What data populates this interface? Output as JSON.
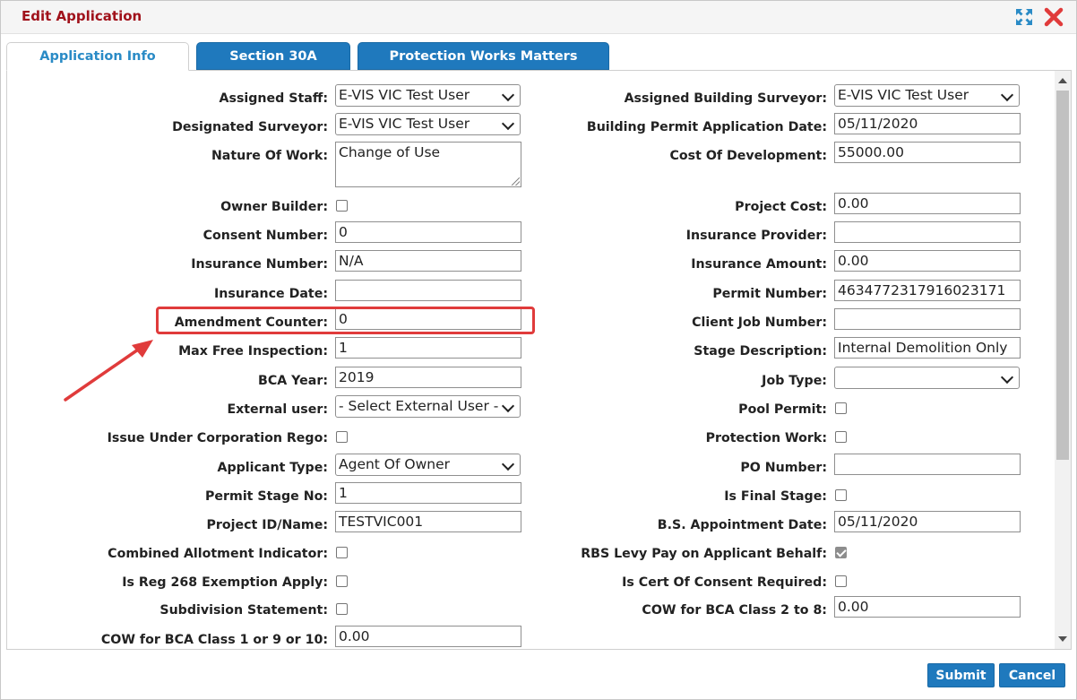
{
  "dialog": {
    "title": "Edit Application"
  },
  "tabs": [
    "Application Info",
    "Section 30A",
    "Protection Works Matters"
  ],
  "left": [
    {
      "label": "Assigned Staff:",
      "type": "select",
      "value": "E-VIS VIC Test User"
    },
    {
      "label": "Designated Surveyor:",
      "type": "select",
      "value": "E-VIS VIC Test User"
    },
    {
      "label": "Nature Of Work:",
      "type": "textarea",
      "value": "Change of Use"
    },
    {
      "label": "Owner Builder:",
      "type": "checkbox",
      "checked": false
    },
    {
      "label": "Consent Number:",
      "type": "text",
      "value": "0"
    },
    {
      "label": "Insurance Number:",
      "type": "text",
      "value": "N/A"
    },
    {
      "label": "Insurance Date:",
      "type": "text",
      "value": ""
    },
    {
      "label": "Amendment Counter:",
      "type": "text",
      "value": "0"
    },
    {
      "label": "Max Free Inspection:",
      "type": "text",
      "value": "1"
    },
    {
      "label": "BCA Year:",
      "type": "text",
      "value": "2019"
    },
    {
      "label": "External user:",
      "type": "select",
      "value": "- Select External User -"
    },
    {
      "label": "Issue Under Corporation Rego:",
      "type": "checkbox",
      "checked": false
    },
    {
      "label": "Applicant Type:",
      "type": "select",
      "value": "Agent Of Owner"
    },
    {
      "label": "Permit Stage No:",
      "type": "text",
      "value": "1"
    },
    {
      "label": "Project ID/Name:",
      "type": "text",
      "value": "TESTVIC001"
    },
    {
      "label": "Combined Allotment Indicator:",
      "type": "checkbox",
      "checked": false
    },
    {
      "label": "Is Reg 268 Exemption Apply:",
      "type": "checkbox",
      "checked": false
    },
    {
      "label": "Subdivision Statement:",
      "type": "checkbox",
      "checked": false
    },
    {
      "label": "COW for BCA Class 1 or 9 or 10:",
      "type": "text",
      "value": "0.00"
    }
  ],
  "right": [
    {
      "label": "Assigned Building Surveyor:",
      "type": "select",
      "value": "E-VIS VIC Test User"
    },
    {
      "label": "Building Permit Application Date:",
      "type": "text",
      "value": "05/11/2020"
    },
    {
      "label": "Cost Of Development:",
      "type": "text",
      "value": "55000.00"
    },
    {
      "label": "Project Cost:",
      "type": "text",
      "value": "0.00"
    },
    {
      "label": "Insurance Provider:",
      "type": "text",
      "value": ""
    },
    {
      "label": "Insurance Amount:",
      "type": "text",
      "value": "0.00"
    },
    {
      "label": "Permit Number:",
      "type": "text",
      "value": "4634772317916023171"
    },
    {
      "label": "Client Job Number:",
      "type": "text",
      "value": ""
    },
    {
      "label": "Stage Description:",
      "type": "text",
      "value": "Internal Demolition Only"
    },
    {
      "label": "Job Type:",
      "type": "select",
      "value": ""
    },
    {
      "label": "Pool Permit:",
      "type": "checkbox",
      "checked": false
    },
    {
      "label": "Protection Work:",
      "type": "checkbox",
      "checked": false
    },
    {
      "label": "PO Number:",
      "type": "text",
      "value": ""
    },
    {
      "label": "Is Final Stage:",
      "type": "checkbox",
      "checked": false
    },
    {
      "label": "B.S. Appointment Date:",
      "type": "text",
      "value": "05/11/2020"
    },
    {
      "label": "RBS Levy Pay on Applicant Behalf:",
      "type": "checkbox",
      "checked": true
    },
    {
      "label": "Is Cert Of Consent Required:",
      "type": "checkbox",
      "checked": false
    },
    {
      "label": "COW for BCA Class 2 to 8:",
      "type": "text",
      "value": "0.00"
    }
  ],
  "footer": {
    "submit": "Submit",
    "cancel": "Cancel"
  },
  "colors": {
    "title": "#a0121b",
    "tab_active_text": "#2a8bc6",
    "button": "#1f79bd",
    "annotation": "#e03b3b"
  }
}
